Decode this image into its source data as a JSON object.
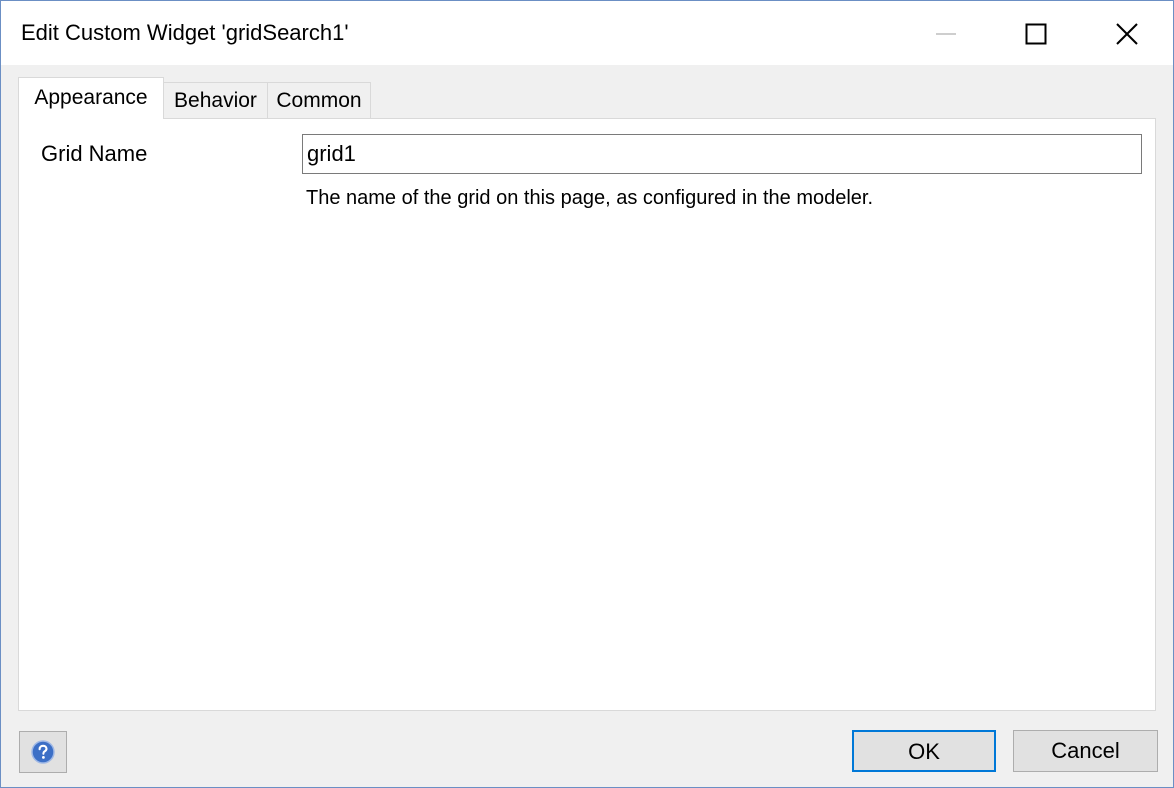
{
  "window": {
    "title": "Edit Custom Widget 'gridSearch1'",
    "caption_buttons": {
      "minimize_icon": "minimize-icon",
      "maximize_icon": "maximize-icon",
      "close_icon": "close-icon"
    }
  },
  "tabs": [
    {
      "label": "Appearance",
      "active": true
    },
    {
      "label": "Behavior",
      "active": false
    },
    {
      "label": "Common",
      "active": false
    }
  ],
  "form": {
    "grid_name": {
      "label": "Grid Name",
      "value": "grid1",
      "help": "The name of the grid on this page, as configured in the modeler."
    }
  },
  "footer": {
    "help_icon": "help-icon",
    "ok_label": "OK",
    "cancel_label": "Cancel"
  },
  "colors": {
    "accent": "#0078d7",
    "window_border": "#6b8fc4",
    "help_icon": "#3c6fc6"
  }
}
